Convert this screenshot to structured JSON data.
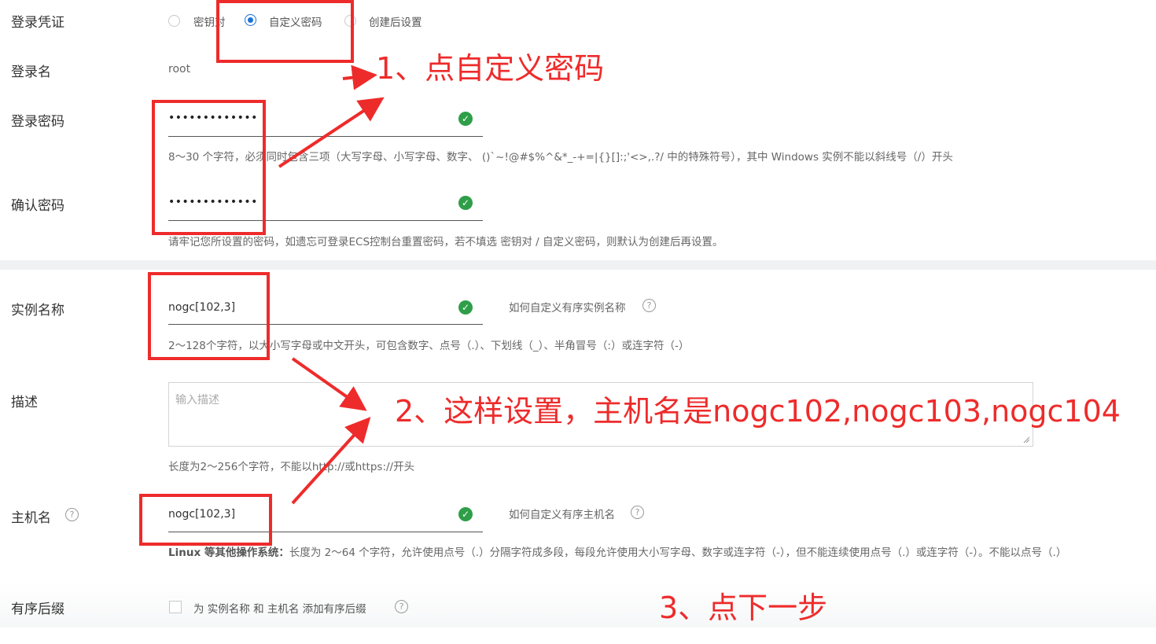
{
  "credentials": {
    "label": "登录凭证",
    "options": [
      "密钥对",
      "自定义密码",
      "创建后设置"
    ],
    "selected": "自定义密码"
  },
  "login_name": {
    "label": "登录名",
    "value": "root"
  },
  "password": {
    "label": "登录密码",
    "value": "•••••••••••••",
    "hint": "8～30 个字符，必须同时包含三项（大写字母、小写字母、数字、 ()`~!@#$%^&*_-+=|{}[]:;'<>,.?/ 中的特殊符号），其中 Windows 实例不能以斜线号（/）开头"
  },
  "confirm_password": {
    "label": "确认密码",
    "value": "•••••••••••••",
    "hint": "请牢记您所设置的密码，如遗忘可登录ECS控制台重置密码，若不填选 密钥对 / 自定义密码，则默认为创建后再设置。"
  },
  "instance_name": {
    "label": "实例名称",
    "value": "nogc[102,3]",
    "help_link": "如何自定义有序实例名称",
    "hint": "2～128个字符，以大小写字母或中文开头，可包含数字、点号（.）、下划线（_）、半角冒号（:）或连字符（-）"
  },
  "description": {
    "label": "描述",
    "placeholder": "输入描述",
    "hint": "长度为2～256个字符，不能以http://或https://开头"
  },
  "hostname": {
    "label": "主机名",
    "value": "nogc[102,3]",
    "help_link": "如何自定义有序主机名",
    "hint_bold": "Linux 等其他操作系统：",
    "hint": "长度为 2～64 个字符，允许使用点号（.）分隔字符成多段，每段允许使用大小写字母、数字或连字符（-），但不能连续使用点号（.）或连字符（-）。不能以点号（.）"
  },
  "ordered_suffix": {
    "label": "有序后缀",
    "checkbox_label": "为 实例名称 和 主机名 添加有序后缀"
  },
  "annotations": {
    "step1": "1、点自定义密码",
    "step2": "2、这样设置，主机名是nogc102,nogc103,nogc104",
    "step3": "3、点下一步",
    "color": "#ee2b2b"
  },
  "colors": {
    "accent": "#1a73d9",
    "success": "#2f9e48"
  }
}
